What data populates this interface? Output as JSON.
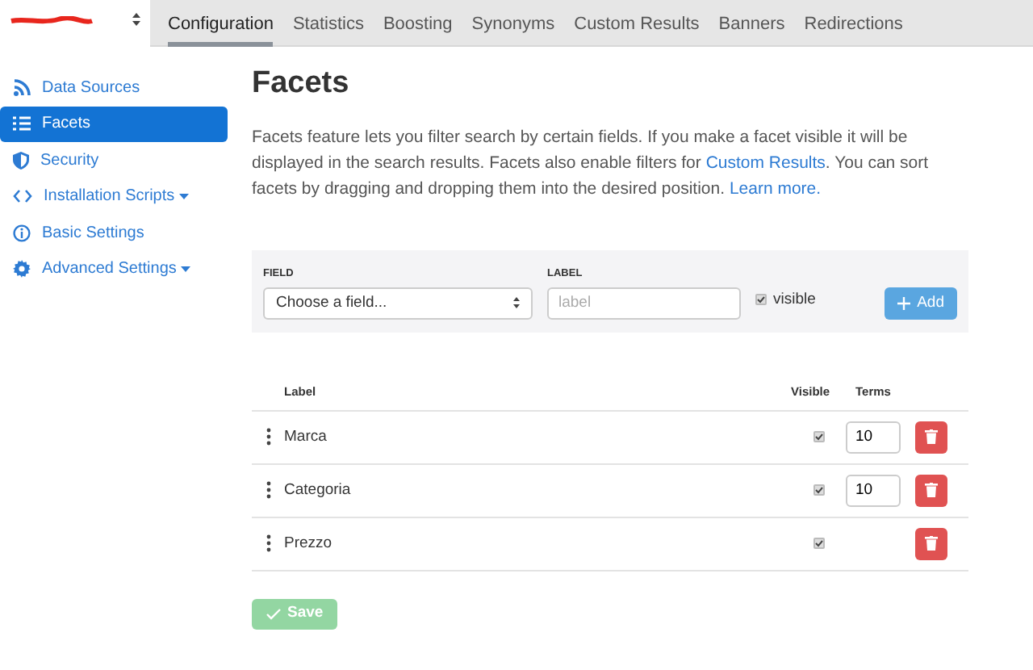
{
  "topbar": {
    "project_selector": {
      "redacted": true
    },
    "tabs": [
      {
        "label": "Configuration",
        "selected": true
      },
      {
        "label": "Statistics",
        "selected": false
      },
      {
        "label": "Boosting",
        "selected": false
      },
      {
        "label": "Synonyms",
        "selected": false
      },
      {
        "label": "Custom Results",
        "selected": false
      },
      {
        "label": "Banners",
        "selected": false
      },
      {
        "label": "Redirections",
        "selected": false
      }
    ]
  },
  "sidebar": {
    "items": [
      {
        "label": "Data Sources",
        "kind": "rss",
        "selected": false,
        "dropdown": false
      },
      {
        "label": "Facets",
        "kind": "list",
        "selected": true,
        "dropdown": false
      },
      {
        "label": "Security",
        "kind": "shield",
        "selected": false,
        "dropdown": false
      },
      {
        "label": "Installation Scripts",
        "kind": "code",
        "selected": false,
        "dropdown": true
      },
      {
        "label": "Basic Settings",
        "kind": "info",
        "selected": false,
        "dropdown": false
      },
      {
        "label": "Advanced Settings",
        "kind": "gear",
        "selected": false,
        "dropdown": true
      }
    ]
  },
  "title": "Facets",
  "intro": {
    "parts": [
      {
        "text": "Facets feature lets you filter search by certain fields. If you make a facet visible it will be displayed in the search results. Facets also enable filters for ",
        "link": false
      },
      {
        "text": "Custom Results",
        "link": true
      },
      {
        "text": ". You can sort facets by dragging and dropping them into the desired position. ",
        "link": false
      },
      {
        "text": "Learn more.",
        "link": true
      }
    ]
  },
  "add_form": {
    "field_label": "FIELD",
    "field_select": "Choose a field...",
    "label_label": "LABEL",
    "label_placeholder": "label",
    "visible": {
      "label": "visible",
      "checked": true
    },
    "add_button": "Add"
  },
  "table": {
    "columns": [
      "Label",
      "Visible",
      "Terms"
    ],
    "rows": [
      {
        "label": "Marca",
        "visible": true,
        "terms": "10"
      },
      {
        "label": "Categoria",
        "visible": true,
        "terms": "10"
      },
      {
        "label": "Prezzo",
        "visible": true
      }
    ]
  },
  "save_button": {
    "label": "Save",
    "disabled": true
  }
}
